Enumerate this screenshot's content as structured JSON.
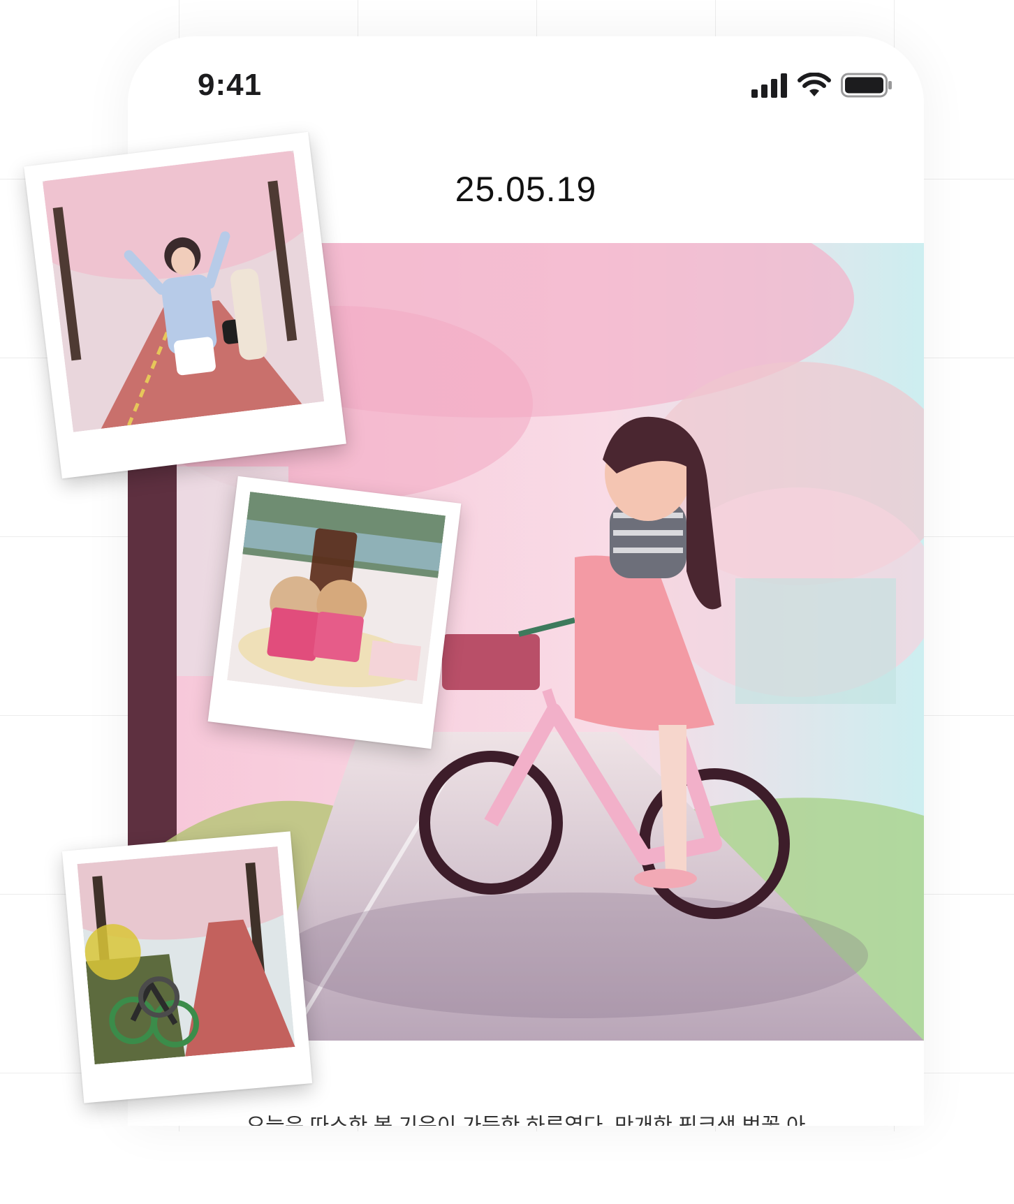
{
  "status_bar": {
    "time": "9:41",
    "icons": [
      "cellular-signal-icon",
      "wifi-icon",
      "battery-icon"
    ]
  },
  "diary": {
    "date": "25.05.19",
    "body_text": "오늘은 따스한 봄 기운이 가득한 하루였다. 만개한 핑크색 벚꽃 아"
  },
  "illustration": {
    "subject": "girl-with-bicycle-under-cherry-blossoms"
  },
  "polaroids": [
    {
      "subject": "woman-under-cherry-blossom-trees"
    },
    {
      "subject": "iced-coffee-and-donuts"
    },
    {
      "subject": "bicycles-on-cherry-blossom-path"
    }
  ],
  "colors": {
    "blossom_pink": "#f4b3cb",
    "path_red": "#c96a6a",
    "text_dark": "#1c1c1e"
  }
}
